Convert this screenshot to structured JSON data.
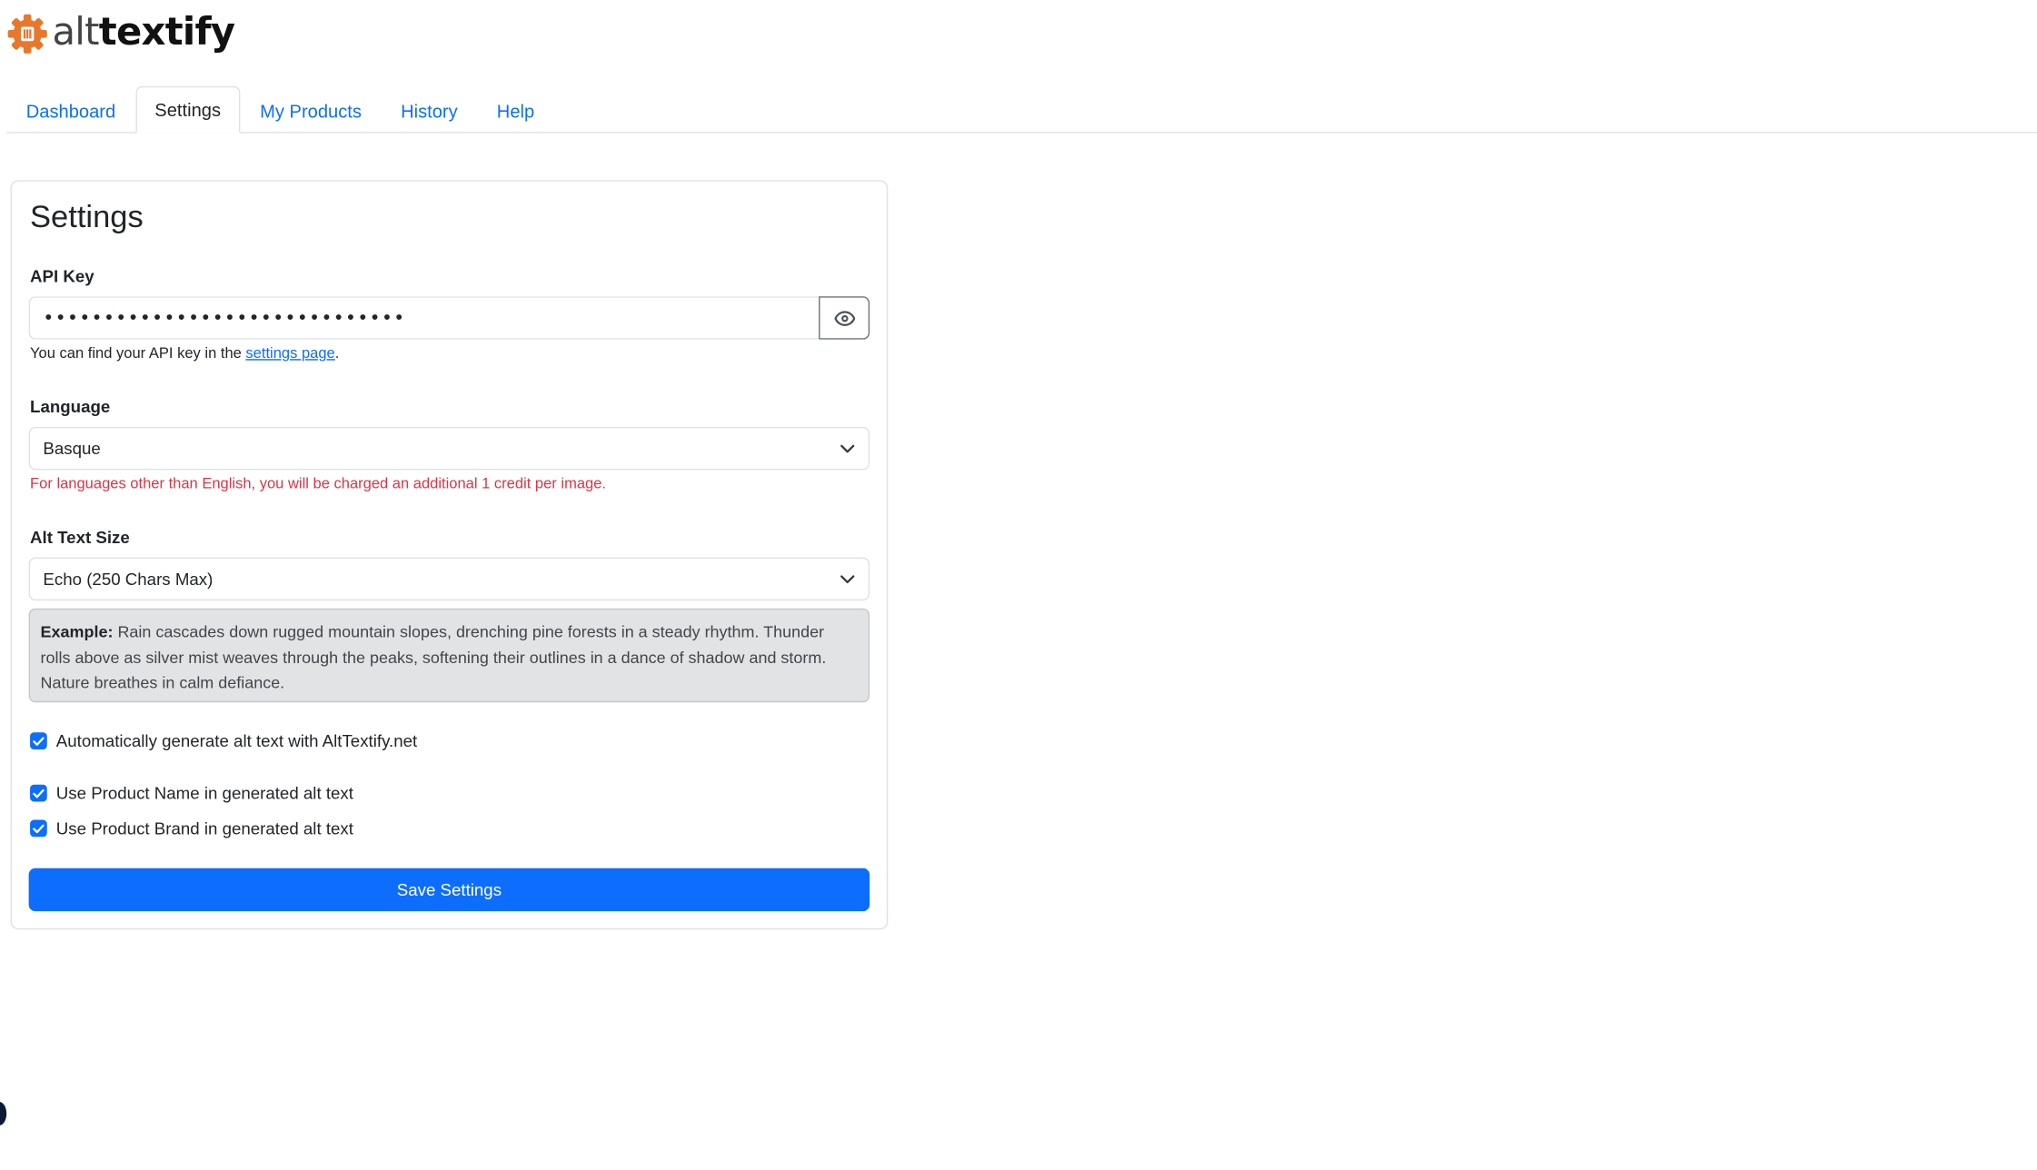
{
  "app": {
    "logo": {
      "icon": "gear-camera-icon",
      "text_part1": "alt",
      "text_part2": "textify",
      "color": "#e8772e"
    }
  },
  "tabs": [
    {
      "label": "Dashboard",
      "active": false
    },
    {
      "label": "Settings",
      "active": true
    },
    {
      "label": "My Products",
      "active": false
    },
    {
      "label": "History",
      "active": false
    },
    {
      "label": "Help",
      "active": false
    }
  ],
  "settings": {
    "title": "Settings",
    "api_key": {
      "label": "API Key",
      "value": "••••••••••••••••••••••••••••••",
      "toggle_icon": "eye-icon",
      "help_prefix": "You can find your API key in the ",
      "help_link": "settings page",
      "help_suffix": "."
    },
    "language": {
      "label": "Language",
      "selected": "Basque",
      "warning": "For languages other than English, you will be charged an additional 1 credit per image."
    },
    "alt_text_size": {
      "label": "Alt Text Size",
      "selected": "Echo (250 Chars Max)",
      "example_label": "Example:",
      "example_text": " Rain cascades down rugged mountain slopes, drenching pine forests in a steady rhythm. Thunder rolls above as silver mist weaves through the peaks, softening their outlines in a dance of shadow and storm. Nature breathes in calm defiance."
    },
    "options": [
      {
        "label": "Automatically generate alt text with AltTextify.net",
        "checked": true
      },
      {
        "label": "Use Product Name in generated alt text",
        "checked": true
      },
      {
        "label": "Use Product Brand in generated alt text",
        "checked": true
      }
    ],
    "save_label": "Save Settings"
  },
  "colors": {
    "primary": "#0d6efd",
    "danger": "#dc3545",
    "border": "#dee2e6"
  }
}
